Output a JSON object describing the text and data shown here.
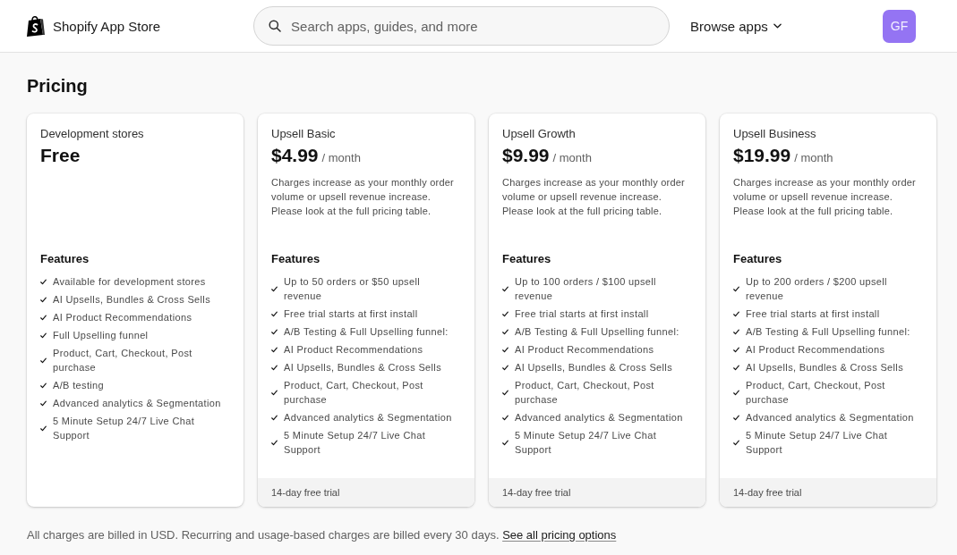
{
  "header": {
    "logo_text": "Shopify App Store",
    "search": {
      "placeholder": "Search apps, guides, and more"
    },
    "browse": "Browse apps",
    "avatar": "GF"
  },
  "page_title": "Pricing",
  "plans": [
    {
      "name": "Development stores",
      "price": "Free",
      "features_title": "Features",
      "features": [
        "Available for development stores",
        "AI Upsells, Bundles & Cross Sells",
        "AI Product Recommendations",
        "Full Upselling funnel",
        "Product, Cart, Checkout, Post purchase",
        "A/B testing",
        "Advanced analytics & Segmentation",
        "5 Minute Setup 24/7 Live Chat Support"
      ]
    },
    {
      "name": "Upsell Basic",
      "price": "$4.99",
      "period": "/ month",
      "description": "Charges increase as your monthly order volume or upsell revenue increase. Please look at the full pricing table.",
      "features_title": "Features",
      "features": [
        "Up to 50 orders or $50 upsell revenue",
        "Free trial starts at first install",
        "A/B Testing & Full Upselling funnel:",
        "AI Product Recommendations",
        "AI Upsells, Bundles & Cross Sells",
        "Product, Cart, Checkout, Post purchase",
        "Advanced analytics & Segmentation",
        "5 Minute Setup 24/7 Live Chat Support"
      ],
      "trial": "14-day free trial"
    },
    {
      "name": "Upsell Growth",
      "price": "$9.99",
      "period": "/ month",
      "description": "Charges increase as your monthly order volume or upsell revenue increase. Please look at the full pricing table.",
      "features_title": "Features",
      "features": [
        "Up to 100 orders / $100 upsell revenue",
        "Free trial starts at first install",
        "A/B Testing & Full Upselling funnel:",
        "AI Product Recommendations",
        "AI Upsells, Bundles & Cross Sells",
        "Product, Cart, Checkout, Post purchase",
        "Advanced analytics & Segmentation",
        "5 Minute Setup 24/7 Live Chat Support"
      ],
      "trial": "14-day free trial"
    },
    {
      "name": "Upsell Business",
      "price": "$19.99",
      "period": "/ month",
      "description": "Charges increase as your monthly order volume or upsell revenue increase. Please look at the full pricing table.",
      "features_title": "Features",
      "features": [
        "Up to 200 orders / $200 upsell revenue",
        "Free trial starts at first install",
        "A/B Testing & Full Upselling funnel:",
        "AI Product Recommendations",
        "AI Upsells, Bundles & Cross Sells",
        "Product, Cart, Checkout, Post purchase",
        "Advanced analytics & Segmentation",
        "5 Minute Setup 24/7 Live Chat Support"
      ],
      "trial": "14-day free trial"
    }
  ],
  "footer": {
    "note": "All charges are billed in USD. Recurring and usage-based charges are billed every 30 days.",
    "link": "See all pricing options"
  }
}
